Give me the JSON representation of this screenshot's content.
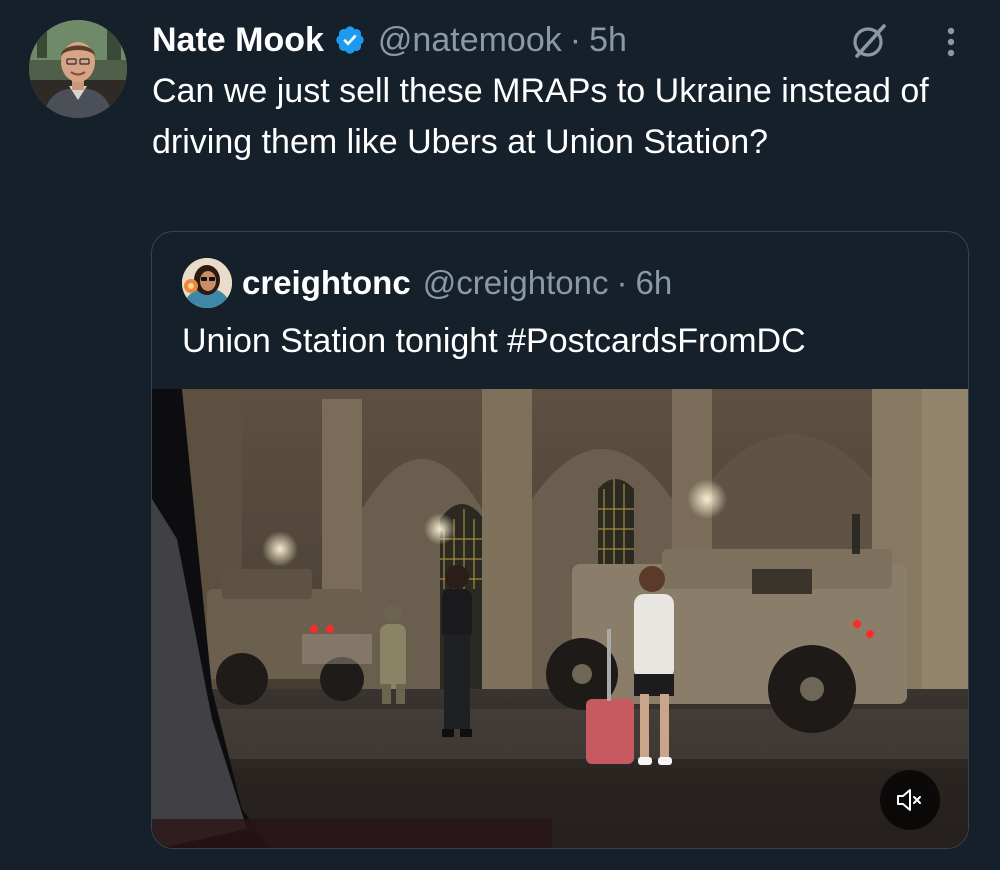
{
  "tweet": {
    "display_name": "Nate Mook",
    "handle": "@natemook",
    "separator": "·",
    "time": "5h",
    "text": "Can we just sell these MRAPs to Ukraine instead of driving them like Ubers at Union Station?"
  },
  "quote": {
    "display_name": "creightonc",
    "handle": "@creightonc",
    "separator": "·",
    "time": "6h",
    "text": "Union Station tonight #PostcardsFromDC"
  },
  "icons": {
    "verified": "verified-badge-icon",
    "grok": "grok-icon",
    "more": "more-options-icon",
    "mute": "volume-muted-icon"
  },
  "colors": {
    "background": "#15202b",
    "secondary_text": "#8b98a5",
    "verified": "#1d9bf0",
    "card_border": "#38444d"
  }
}
